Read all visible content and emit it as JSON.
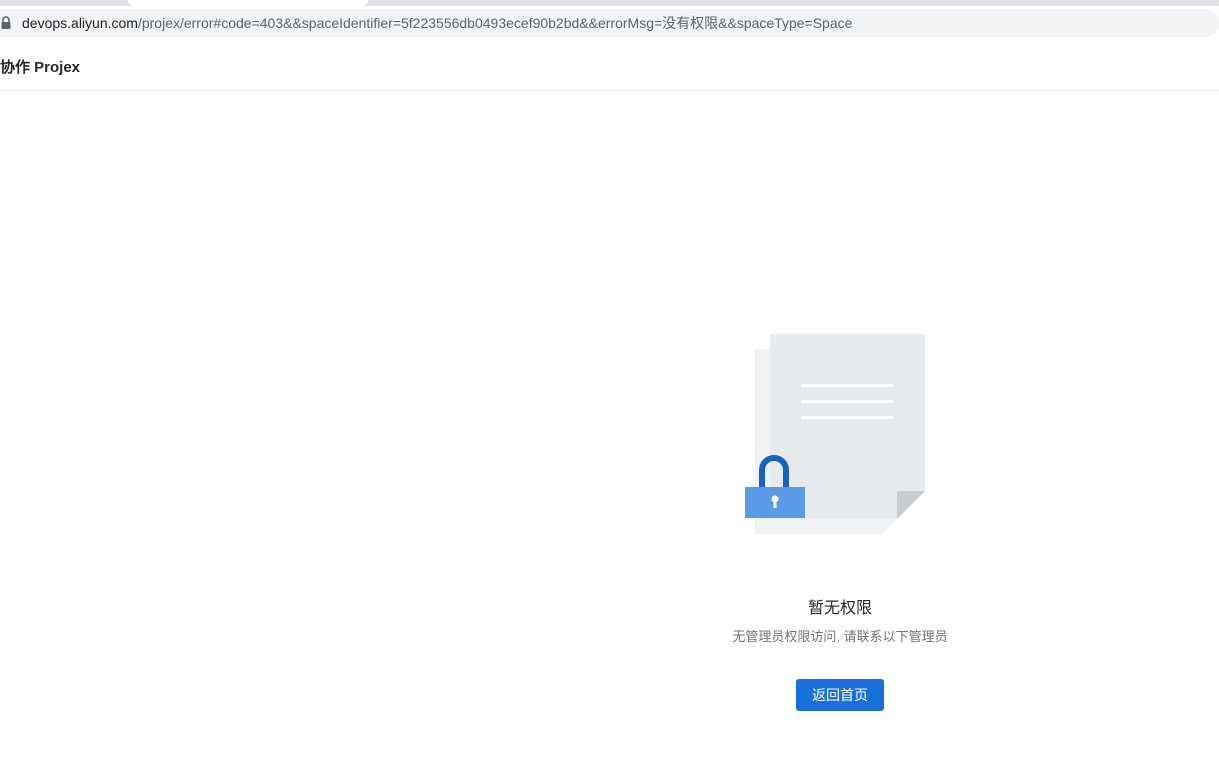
{
  "browser": {
    "url_host": "devops.aliyun.com",
    "url_path": "/projex/error#code=403&&spaceIdentifier=5f223556db0493ecef90b2bd&&errorMsg=没有权限&&spaceType=Space",
    "lock_icon": "lock-icon"
  },
  "header": {
    "title": "协作 Projex"
  },
  "empty_state": {
    "illustration": "locked-document-illustration",
    "title": "暂无权限",
    "description": "无管理员权限访问, 请联系以下管理员",
    "button_label": "返回首页"
  },
  "colors": {
    "primary": "#1b6fd8",
    "lock_blue": "#5b9be6",
    "lock_shackle": "#1565c0",
    "paper": "#e8ebee",
    "paper_back": "#f2f4f6"
  }
}
